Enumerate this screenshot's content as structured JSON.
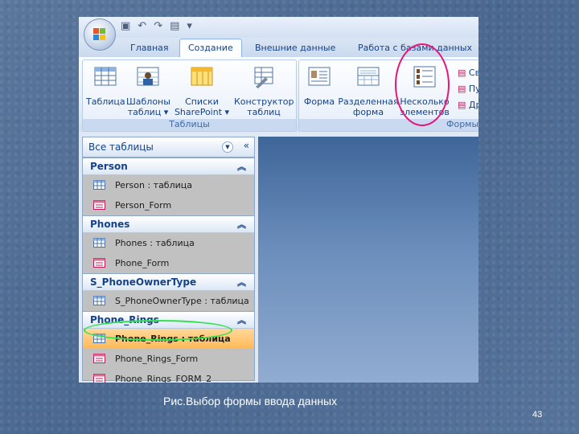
{
  "ribbon": {
    "tabs": [
      "Главная",
      "Создание",
      "Внешние данные",
      "Работа с базами данных"
    ],
    "active_tab": "Создание",
    "groups": {
      "tables": {
        "label": "Таблицы",
        "buttons": [
          {
            "line1": "Таблица",
            "line2": "",
            "icon": "table-icon"
          },
          {
            "line1": "Шаблоны",
            "line2": "таблиц ▾",
            "icon": "table-templates-icon"
          },
          {
            "line1": "Списки",
            "line2": "SharePoint ▾",
            "icon": "sharepoint-lists-icon"
          },
          {
            "line1": "Конструктор",
            "line2": "таблиц",
            "icon": "table-design-icon"
          }
        ]
      },
      "forms": {
        "label": "Формы",
        "buttons": [
          {
            "line1": "Форма",
            "line2": "",
            "icon": "form-icon"
          },
          {
            "line1": "Разделенная",
            "line2": "форма",
            "icon": "split-form-icon"
          },
          {
            "line1": "Несколько",
            "line2": "элементов",
            "icon": "multiple-items-icon"
          }
        ],
        "side_items": [
          "Св",
          "Пу",
          "Др"
        ]
      }
    }
  },
  "nav": {
    "title": "Все таблицы",
    "groups": [
      {
        "name": "Person",
        "items": [
          {
            "label": "Person : таблица",
            "kind": "table"
          },
          {
            "label": "Person_Form",
            "kind": "form"
          }
        ]
      },
      {
        "name": "Phones",
        "items": [
          {
            "label": "Phones : таблица",
            "kind": "table"
          },
          {
            "label": "Phone_Form",
            "kind": "form"
          }
        ]
      },
      {
        "name": "S_PhoneOwnerType",
        "items": [
          {
            "label": "S_PhoneOwnerType : таблица",
            "kind": "table"
          }
        ]
      },
      {
        "name": "Phone_Rings",
        "items": [
          {
            "label": "Phone_Rings : таблица",
            "kind": "table",
            "selected": true
          },
          {
            "label": "Phone_Rings_Form",
            "kind": "form"
          },
          {
            "label": "Phone_Rings_FORM_2",
            "kind": "form"
          }
        ]
      }
    ]
  },
  "caption": "Рис.Выбор формы ввода данных",
  "page_number": "43",
  "colors": {
    "annotation_magenta": "#e5157a",
    "annotation_green": "#2fe34f",
    "selected_item": "#ffc97a",
    "ribbon_text": "#15428b"
  }
}
